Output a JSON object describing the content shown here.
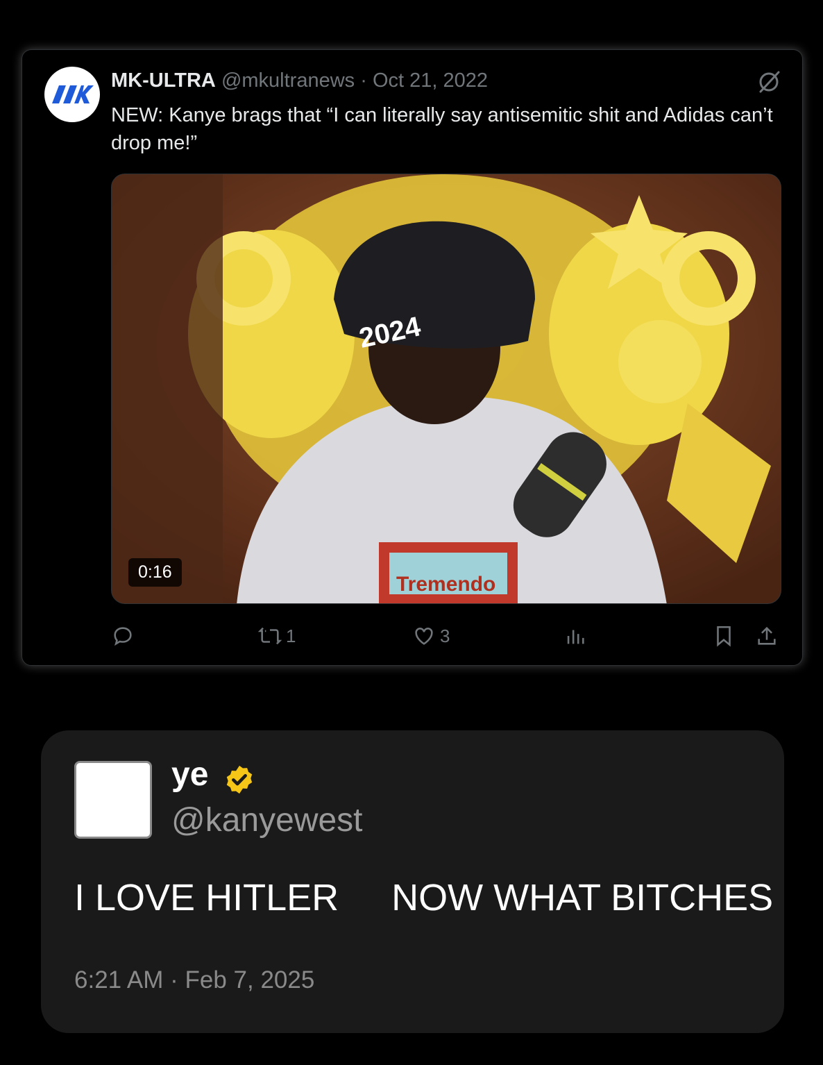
{
  "tweet1": {
    "display_name": "MK-ULTRA",
    "handle": "@mkultranews",
    "separator": "·",
    "date": "Oct 21, 2022",
    "text": "NEW: Kanye brags that “I can literally say antisemitic shit and Adidas can’t drop me!”",
    "media": {
      "duration": "0:16",
      "cap_text": "2024",
      "shirt_text": "Tremendo"
    },
    "icons": {
      "avatar_logo": "mk-logo",
      "grok": "grok-icon"
    },
    "actions": {
      "reply_count": "",
      "retweet_count": "1",
      "like_count": "3",
      "views_count": "",
      "icons": [
        "reply-icon",
        "retweet-icon",
        "like-icon",
        "views-icon",
        "bookmark-icon",
        "share-icon"
      ]
    }
  },
  "tweet2": {
    "display_name": "ye",
    "handle": "@kanyewest",
    "text_part1": "I LOVE HITLER",
    "text_part2": "NOW WHAT BITCHES",
    "timestamp": "6:21 AM · Feb 7, 2025",
    "verified_color": "#f5c518"
  },
  "colors": {
    "background": "#000000",
    "secondary_text": "#71767b",
    "card2_background": "#1a1a1a"
  }
}
